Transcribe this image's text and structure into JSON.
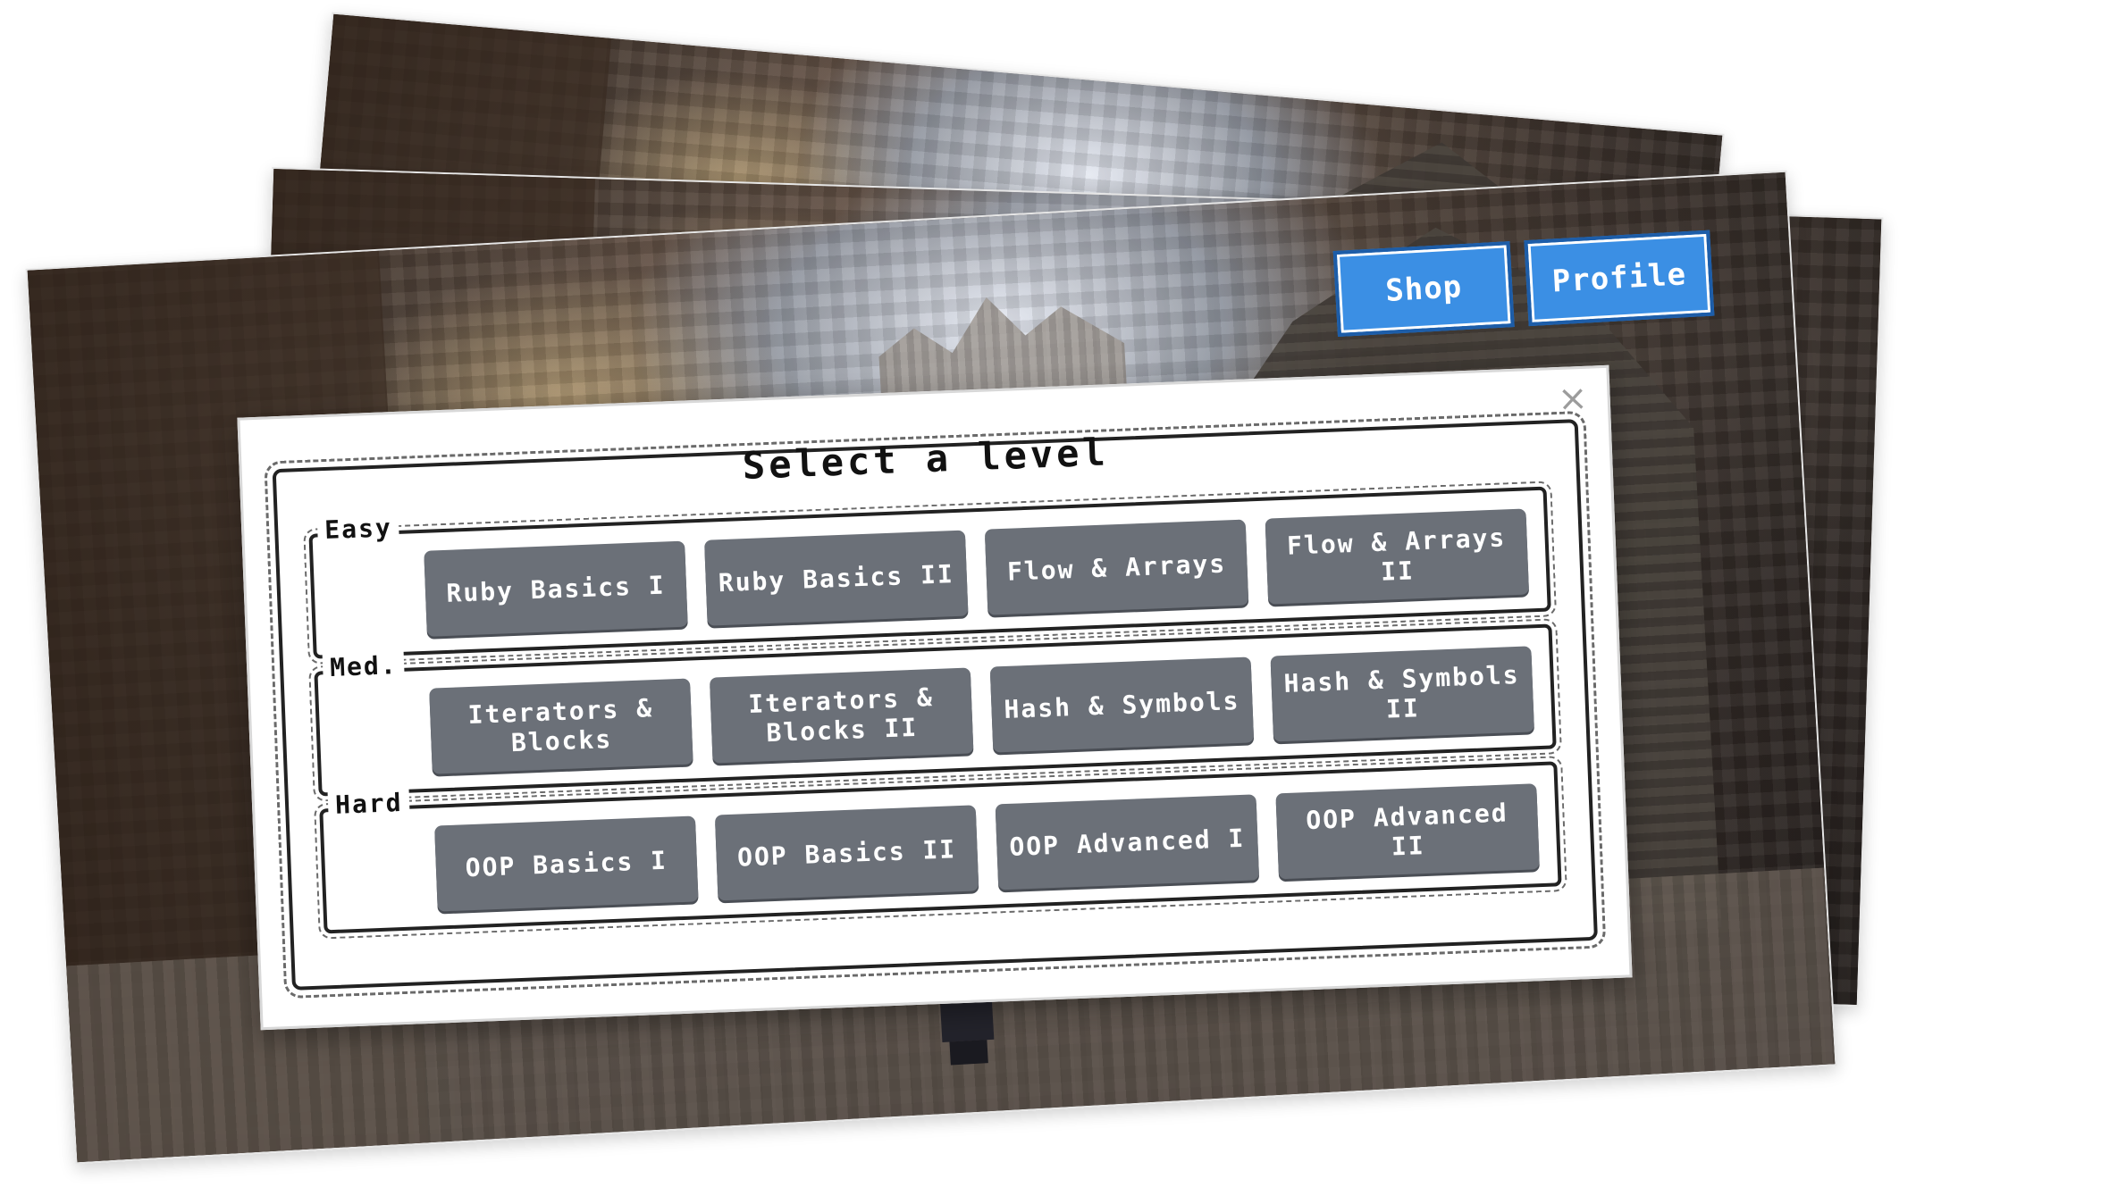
{
  "nav": {
    "shop_label": "Shop",
    "profile_label": "Profile"
  },
  "modal": {
    "title": "Select a level",
    "close_icon": "×",
    "groups": [
      {
        "label": "Easy",
        "levels": [
          "Ruby Basics I",
          "Ruby Basics II",
          "Flow & Arrays",
          "Flow & Arrays II"
        ]
      },
      {
        "label": "Med.",
        "levels": [
          "Iterators & Blocks",
          "Iterators & Blocks II",
          "Hash & Symbols",
          "Hash & Symbols II"
        ]
      },
      {
        "label": "Hard",
        "levels": [
          "OOP Basics I",
          "OOP Basics II",
          "OOP Advanced I",
          "OOP Advanced II"
        ]
      }
    ]
  },
  "colors": {
    "button_blue": "#3b8fe4",
    "level_button_gray": "#6b7078",
    "modal_bg": "#ffffff"
  }
}
